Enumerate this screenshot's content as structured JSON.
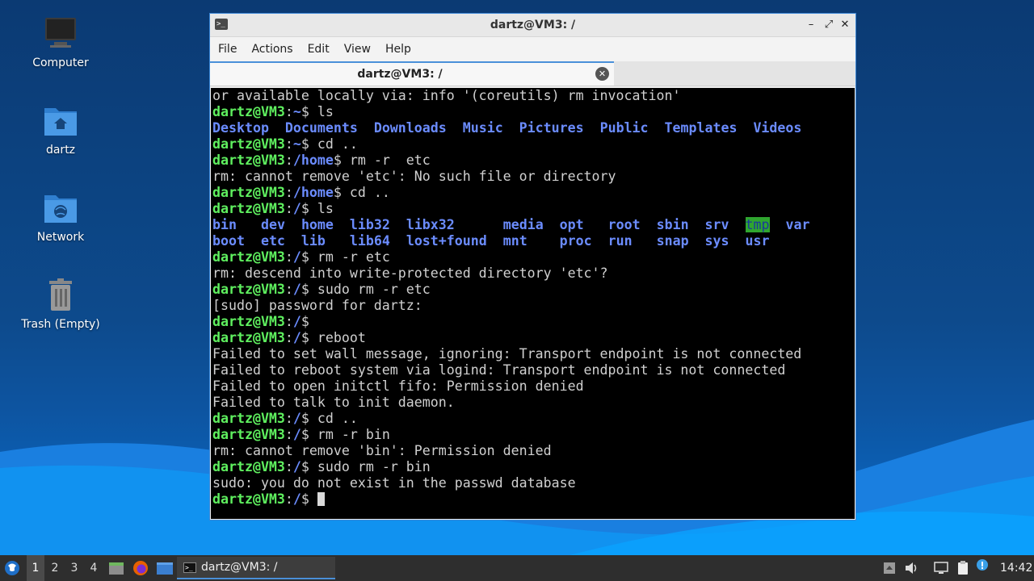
{
  "desktop": {
    "icons": [
      {
        "label": "Computer",
        "icon": "computer-icon"
      },
      {
        "label": "dartz",
        "icon": "home-folder-icon"
      },
      {
        "label": "Network",
        "icon": "network-folder-icon"
      },
      {
        "label": "Trash (Empty)",
        "icon": "trash-icon"
      }
    ]
  },
  "window": {
    "title": "dartz@VM3: /",
    "controls": {
      "minimize": "–",
      "maximize": "⤢",
      "close": "✕"
    },
    "menu": [
      "File",
      "Actions",
      "Edit",
      "View",
      "Help"
    ],
    "tab": {
      "label": "dartz@VM3: /",
      "close": "✕"
    }
  },
  "terminal": {
    "lines": [
      [
        {
          "t": "or available locally via: info '(coreutils) rm invocation'"
        }
      ],
      [
        {
          "t": "dartz@VM3",
          "c": "pu"
        },
        {
          "t": ":"
        },
        {
          "t": "~",
          "c": "pp"
        },
        {
          "t": "$ ls"
        }
      ],
      [
        {
          "t": "Desktop",
          "c": "dir"
        },
        {
          "t": "  "
        },
        {
          "t": "Documents",
          "c": "dir"
        },
        {
          "t": "  "
        },
        {
          "t": "Downloads",
          "c": "dir"
        },
        {
          "t": "  "
        },
        {
          "t": "Music",
          "c": "dir"
        },
        {
          "t": "  "
        },
        {
          "t": "Pictures",
          "c": "dir"
        },
        {
          "t": "  "
        },
        {
          "t": "Public",
          "c": "dir"
        },
        {
          "t": "  "
        },
        {
          "t": "Templates",
          "c": "dir"
        },
        {
          "t": "  "
        },
        {
          "t": "Videos",
          "c": "dir"
        }
      ],
      [
        {
          "t": "dartz@VM3",
          "c": "pu"
        },
        {
          "t": ":"
        },
        {
          "t": "~",
          "c": "pp"
        },
        {
          "t": "$ cd .."
        }
      ],
      [
        {
          "t": "dartz@VM3",
          "c": "pu"
        },
        {
          "t": ":"
        },
        {
          "t": "/home",
          "c": "pp"
        },
        {
          "t": "$ rm -r  etc"
        }
      ],
      [
        {
          "t": "rm: cannot remove 'etc': No such file or directory"
        }
      ],
      [
        {
          "t": "dartz@VM3",
          "c": "pu"
        },
        {
          "t": ":"
        },
        {
          "t": "/home",
          "c": "pp"
        },
        {
          "t": "$ cd .."
        }
      ],
      [
        {
          "t": "dartz@VM3",
          "c": "pu"
        },
        {
          "t": ":"
        },
        {
          "t": "/",
          "c": "pp"
        },
        {
          "t": "$ ls"
        }
      ],
      [
        {
          "t": "bin",
          "c": "dir"
        },
        {
          "t": "   "
        },
        {
          "t": "dev",
          "c": "dir"
        },
        {
          "t": "  "
        },
        {
          "t": "home",
          "c": "dir"
        },
        {
          "t": "  "
        },
        {
          "t": "lib32",
          "c": "dir"
        },
        {
          "t": "  "
        },
        {
          "t": "libx32",
          "c": "dir"
        },
        {
          "t": "      "
        },
        {
          "t": "media",
          "c": "dir"
        },
        {
          "t": "  "
        },
        {
          "t": "opt",
          "c": "dir"
        },
        {
          "t": "   "
        },
        {
          "t": "root",
          "c": "dir"
        },
        {
          "t": "  "
        },
        {
          "t": "sbin",
          "c": "dir"
        },
        {
          "t": "  "
        },
        {
          "t": "srv",
          "c": "dir"
        },
        {
          "t": "  "
        },
        {
          "t": "tmp",
          "c": "tmp"
        },
        {
          "t": "  "
        },
        {
          "t": "var",
          "c": "dir"
        }
      ],
      [
        {
          "t": "boot",
          "c": "dir"
        },
        {
          "t": "  "
        },
        {
          "t": "etc",
          "c": "dir"
        },
        {
          "t": "  "
        },
        {
          "t": "lib",
          "c": "dir"
        },
        {
          "t": "   "
        },
        {
          "t": "lib64",
          "c": "dir"
        },
        {
          "t": "  "
        },
        {
          "t": "lost+found",
          "c": "dir"
        },
        {
          "t": "  "
        },
        {
          "t": "mnt",
          "c": "dir"
        },
        {
          "t": "    "
        },
        {
          "t": "proc",
          "c": "dir"
        },
        {
          "t": "  "
        },
        {
          "t": "run",
          "c": "dir"
        },
        {
          "t": "   "
        },
        {
          "t": "snap",
          "c": "dir"
        },
        {
          "t": "  "
        },
        {
          "t": "sys",
          "c": "dir"
        },
        {
          "t": "  "
        },
        {
          "t": "usr",
          "c": "dir"
        }
      ],
      [
        {
          "t": "dartz@VM3",
          "c": "pu"
        },
        {
          "t": ":"
        },
        {
          "t": "/",
          "c": "pp"
        },
        {
          "t": "$ rm -r etc"
        }
      ],
      [
        {
          "t": "rm: descend into write-protected directory 'etc'?"
        }
      ],
      [
        {
          "t": "dartz@VM3",
          "c": "pu"
        },
        {
          "t": ":"
        },
        {
          "t": "/",
          "c": "pp"
        },
        {
          "t": "$ sudo rm -r etc"
        }
      ],
      [
        {
          "t": "[sudo] password for dartz:"
        }
      ],
      [
        {
          "t": "dartz@VM3",
          "c": "pu"
        },
        {
          "t": ":"
        },
        {
          "t": "/",
          "c": "pp"
        },
        {
          "t": "$"
        }
      ],
      [
        {
          "t": "dartz@VM3",
          "c": "pu"
        },
        {
          "t": ":"
        },
        {
          "t": "/",
          "c": "pp"
        },
        {
          "t": "$ reboot"
        }
      ],
      [
        {
          "t": "Failed to set wall message, ignoring: Transport endpoint is not connected"
        }
      ],
      [
        {
          "t": "Failed to reboot system via logind: Transport endpoint is not connected"
        }
      ],
      [
        {
          "t": "Failed to open initctl fifo: Permission denied"
        }
      ],
      [
        {
          "t": "Failed to talk to init daemon."
        }
      ],
      [
        {
          "t": "dartz@VM3",
          "c": "pu"
        },
        {
          "t": ":"
        },
        {
          "t": "/",
          "c": "pp"
        },
        {
          "t": "$ cd .."
        }
      ],
      [
        {
          "t": "dartz@VM3",
          "c": "pu"
        },
        {
          "t": ":"
        },
        {
          "t": "/",
          "c": "pp"
        },
        {
          "t": "$ rm -r bin"
        }
      ],
      [
        {
          "t": "rm: cannot remove 'bin': Permission denied"
        }
      ],
      [
        {
          "t": "dartz@VM3",
          "c": "pu"
        },
        {
          "t": ":"
        },
        {
          "t": "/",
          "c": "pp"
        },
        {
          "t": "$ sudo rm -r bin"
        }
      ],
      [
        {
          "t": "sudo: you do not exist in the passwd database"
        }
      ],
      [
        {
          "t": "dartz@VM3",
          "c": "pu"
        },
        {
          "t": ":"
        },
        {
          "t": "/",
          "c": "pp"
        },
        {
          "t": "$ "
        }
      ]
    ]
  },
  "taskbar": {
    "workspaces": [
      "1",
      "2",
      "3",
      "4"
    ],
    "active_workspace": "1",
    "task": {
      "label": "dartz@VM3: /"
    },
    "clock": "14:42",
    "tray_icons": [
      "show-desktop-icon",
      "volume-icon",
      "display-icon",
      "clipboard-icon",
      "update-notifier-icon"
    ]
  },
  "colors": {
    "prompt_user": "#5ff05f",
    "prompt_path": "#6b8cff",
    "accent": "#4a90d9"
  }
}
